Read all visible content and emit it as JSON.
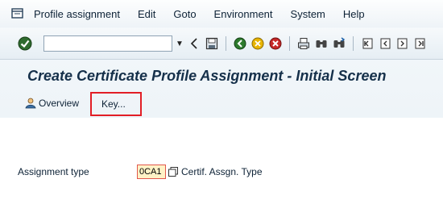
{
  "menu": {
    "items": [
      {
        "label": "Profile assignment"
      },
      {
        "label": "Edit"
      },
      {
        "label": "Goto"
      },
      {
        "label": "Environment"
      },
      {
        "label": "System"
      },
      {
        "label": "Help"
      }
    ]
  },
  "toolbar": {
    "command_field_value": ""
  },
  "screen": {
    "title": "Create Certificate Profile Assignment - Initial Screen"
  },
  "app_toolbar": {
    "overview_label": "Overview",
    "key_label": "Key...",
    "highlight_color": "#e21e26"
  },
  "form": {
    "assignment_type_label": "Assignment type",
    "assignment_type_value": "0CA1",
    "assignment_type_description": "Certif. Assgn. Type"
  }
}
